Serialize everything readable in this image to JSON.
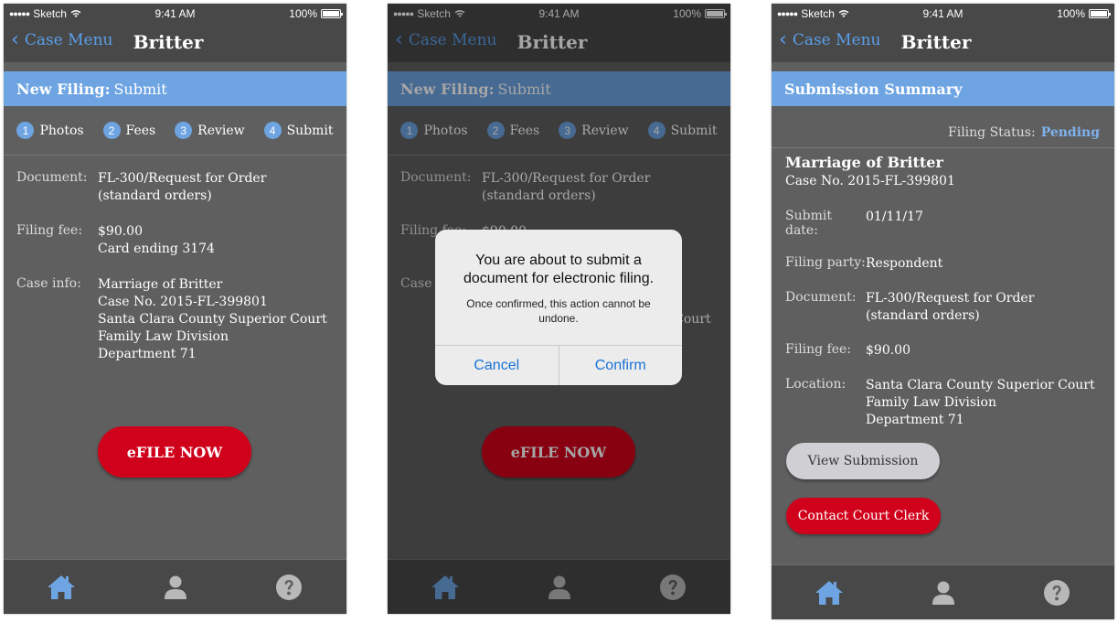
{
  "status": {
    "carrier": "Sketch",
    "time": "9:41 AM",
    "battery": "100%",
    "signal_dots": "●●●●●"
  },
  "nav": {
    "back_label": "Case Menu",
    "title": "Britter"
  },
  "screen1": {
    "banner_bold": "New Filing:",
    "banner_light": "Submit",
    "steps": [
      {
        "n": "1",
        "label": "Photos"
      },
      {
        "n": "2",
        "label": "Fees"
      },
      {
        "n": "3",
        "label": "Review"
      },
      {
        "n": "4",
        "label": "Submit"
      }
    ],
    "rows": [
      {
        "label": "Document:",
        "values": [
          "FL-300/Request for Order",
          "(standard orders)"
        ]
      },
      {
        "label": "Filing fee:",
        "values": [
          "$90.00",
          "Card ending 3174"
        ]
      },
      {
        "label": "Case info:",
        "values": [
          "Marriage of Britter",
          "Case No. 2015-FL-399801",
          "Santa Clara County Superior Court",
          "Family Law Division",
          "Department 71"
        ]
      }
    ],
    "action_label": "eFILE NOW"
  },
  "dialog": {
    "title": "You are about to submit a document for electronic filing.",
    "message": "Once confirmed, this action cannot be undone.",
    "cancel": "Cancel",
    "confirm": "Confirm"
  },
  "screen3": {
    "banner": "Submission Summary",
    "status_label": "Filing Status:",
    "status_value": "Pending",
    "case_title": "Marriage of Britter",
    "case_no": "Case No. 2015-FL-399801",
    "rows": [
      {
        "label": "Submit date:",
        "values": [
          "01/11/17"
        ]
      },
      {
        "label": "Filing party:",
        "values": [
          "Respondent"
        ]
      },
      {
        "label": "Document:",
        "values": [
          "FL-300/Request for Order",
          "(standard orders)"
        ]
      },
      {
        "label": "Filing fee:",
        "values": [
          "$90.00"
        ]
      },
      {
        "label": "Location:",
        "values": [
          "Santa Clara County Superior Court",
          "Family Law Division",
          "Department 71"
        ]
      }
    ],
    "view_label": "View Submission",
    "clerk_label": "Contact Court Clerk"
  },
  "tabs": [
    {
      "icon": "home-icon"
    },
    {
      "icon": "user-icon"
    },
    {
      "icon": "help-icon"
    }
  ],
  "colors": {
    "accent": "#6ea4e2",
    "link": "#5b9ee8",
    "danger": "#d0021b",
    "background": "#5f5f5f",
    "bars": "#484848"
  }
}
